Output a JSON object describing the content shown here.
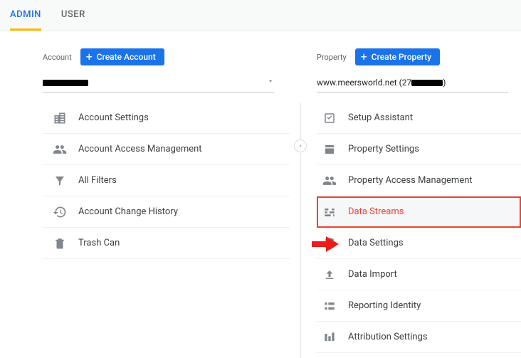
{
  "tabs": {
    "admin": "ADMIN",
    "user": "USER"
  },
  "account": {
    "head_label": "Account",
    "create_label": "Create Account",
    "items": [
      {
        "label": "Account Settings"
      },
      {
        "label": "Account Access Management"
      },
      {
        "label": "All Filters"
      },
      {
        "label": "Account Change History"
      },
      {
        "label": "Trash Can"
      }
    ]
  },
  "property": {
    "head_label": "Property",
    "create_label": "Create Property",
    "selected_prefix": "www.meersworld.net (27",
    "selected_suffix": ")",
    "items": [
      {
        "label": "Setup Assistant"
      },
      {
        "label": "Property Settings"
      },
      {
        "label": "Property Access Management"
      },
      {
        "label": "Data Streams"
      },
      {
        "label": "Data Settings"
      },
      {
        "label": "Data Import"
      },
      {
        "label": "Reporting Identity"
      },
      {
        "label": "Attribution Settings"
      }
    ]
  }
}
